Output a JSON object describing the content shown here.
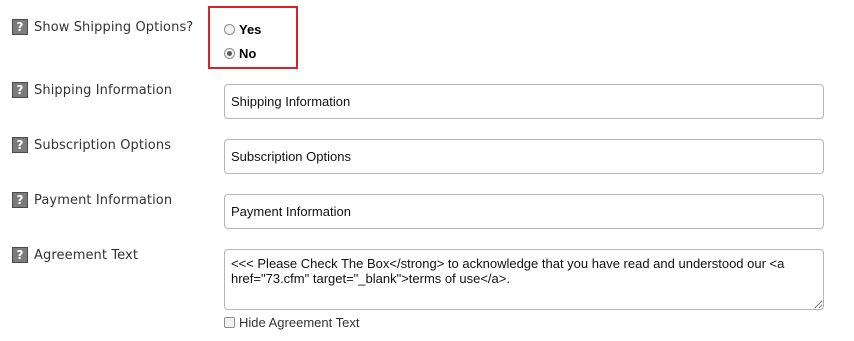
{
  "icons": {
    "help": "help-icon"
  },
  "accent": {
    "highlight_border": "#d6232a"
  },
  "shipping_options": {
    "label": "Show Shipping Options?",
    "help_glyph": "?",
    "options": [
      {
        "label": "Yes",
        "checked": false
      },
      {
        "label": "No",
        "checked": true
      }
    ]
  },
  "fields": [
    {
      "label": "Shipping Information",
      "help_glyph": "?",
      "value": "Shipping Information"
    },
    {
      "label": "Subscription Options",
      "help_glyph": "?",
      "value": "Subscription Options"
    },
    {
      "label": "Payment Information",
      "help_glyph": "?",
      "value": "Payment Information"
    }
  ],
  "agreement": {
    "label": "Agreement Text",
    "help_glyph": "?",
    "value": "<<< Please Check The Box</strong> to acknowledge that you have read and understood our <a href=\"73.cfm\" target=\"_blank\">terms of use</a>.",
    "hide_label": "Hide Agreement Text",
    "hide_checked": false
  }
}
